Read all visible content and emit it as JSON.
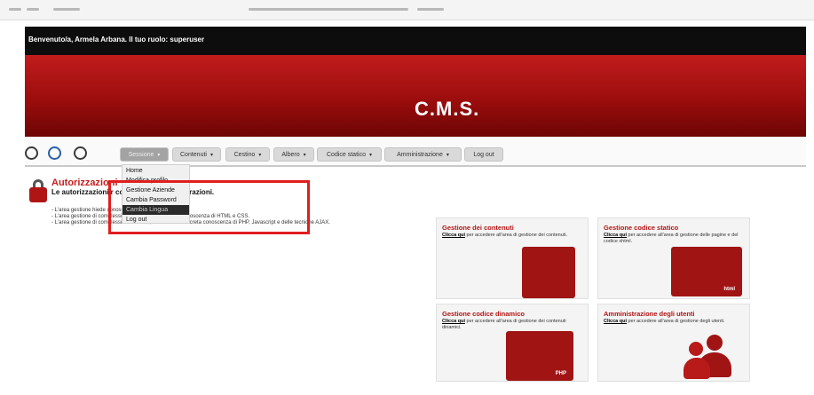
{
  "header": {
    "welcome": "Benvenuto/a, Armela Arbana. Il tuo ruolo: superuser",
    "title": "C.M.S."
  },
  "nav": {
    "items": [
      {
        "label": "Sessione"
      },
      {
        "label": "Contenuti"
      },
      {
        "label": "Cestino"
      },
      {
        "label": "Albero"
      },
      {
        "label": "Codice statico"
      },
      {
        "label": "Amministrazione"
      },
      {
        "label": "Log out"
      }
    ],
    "caret": "▾"
  },
  "dropdown": {
    "items": [
      {
        "label": "Home"
      },
      {
        "label": "Modifica profilo"
      },
      {
        "label": "Gestione Aziende"
      },
      {
        "label": "Cambia Password"
      },
      {
        "label": "Cambia Lingua"
      },
      {
        "label": "Log out"
      }
    ]
  },
  "auth": {
    "title": "Autorizzazioni",
    "subtitle": "Le autorizzazioni r complessità delle operazioni.",
    "lines": [
      "- L'area gestione hiede conoscenze particolari.",
      "- L'area gestione di complessità intermedia, richiede la conoscenza di HTML e CSS.",
      "- L'area gestione di complessità avanzata, richiede una discreta conoscenza di PHP, Javascript e delle tecniche AJAX."
    ]
  },
  "panels": [
    {
      "title": "Gestione dei contenuti",
      "link": "Clicca qui",
      "desc": " per accedere all'area di gestione dei contenuti.",
      "tag": ""
    },
    {
      "title": "Gestione codice statico",
      "link": "Clicca qui",
      "desc": " per accedere all'area di gestione delle pagine e del codice xhtml.",
      "tag": "html"
    },
    {
      "title": "Gestione codice dinamico",
      "link": "Clicca qui",
      "desc": " per accedere all'area di gestione dei contenuti dinamici.",
      "tag": "PHP"
    },
    {
      "title": "Amministrazione degli utenti",
      "link": "Clicca qui",
      "desc": " per accedere all'area di gestione degli utenti.",
      "tag": ""
    }
  ],
  "colors": {
    "accent": "#b01515",
    "highlight": "#e01e1e",
    "topbar": "#0d0d0d"
  }
}
